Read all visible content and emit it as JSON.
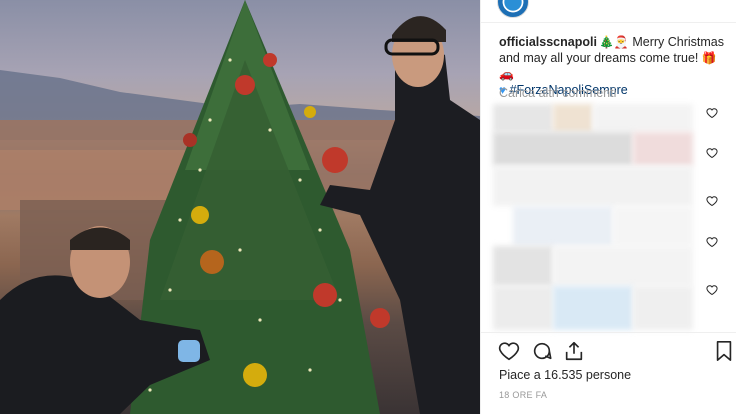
{
  "post": {
    "username": "officialsscnapoli",
    "caption_text": "Merry Christmas and may all your dreams come true!",
    "hashtag": "#ForzaNapoliSempre",
    "load_more_comments": "Carica altri commenti",
    "likes_text": "Piace a 16.535 persone",
    "timestamp": "18 ORE FA"
  },
  "icons": {
    "like": "heart-icon",
    "comment": "comment-icon",
    "share": "share-icon",
    "save": "bookmark-icon",
    "comment_like": "heart-outline-icon"
  },
  "colors": {
    "text": "#262626",
    "muted": "#999999",
    "hashtag": "#003569",
    "border": "#efefef"
  }
}
